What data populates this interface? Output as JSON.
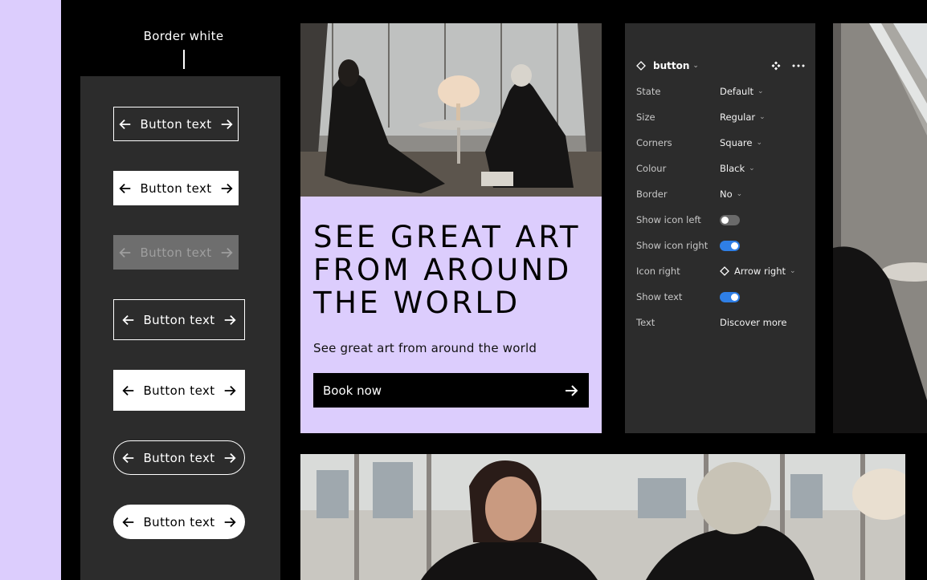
{
  "showcase": {
    "label": "Border white",
    "buttons": [
      {
        "text": "Button text"
      },
      {
        "text": "Button text"
      },
      {
        "text": "Button text"
      },
      {
        "text": "Button text"
      },
      {
        "text": "Button text"
      },
      {
        "text": "Button text"
      },
      {
        "text": "Button text"
      }
    ]
  },
  "promo": {
    "title_lines": [
      "SEE GREAT ART",
      "FROM AROUND",
      "THE WORLD"
    ],
    "subtitle": "See great art from around the world",
    "cta_label": "Book now"
  },
  "properties": {
    "component_name": "button",
    "rows": [
      {
        "label": "State",
        "value": "Default"
      },
      {
        "label": "Size",
        "value": "Regular"
      },
      {
        "label": "Corners",
        "value": "Square"
      },
      {
        "label": "Colour",
        "value": "Black"
      },
      {
        "label": "Border",
        "value": "No"
      },
      {
        "label": "Show icon left",
        "toggle": false
      },
      {
        "label": "Show icon right",
        "toggle": true
      },
      {
        "label": "Icon right",
        "value": "Arrow right"
      },
      {
        "label": "Show text",
        "toggle": true
      },
      {
        "label": "Text",
        "value": "Discover more"
      }
    ]
  },
  "colors": {
    "accent_lilac": "#dccdfd",
    "panel_dark": "#2c2c2c",
    "toggle_on": "#2f7fe6"
  }
}
